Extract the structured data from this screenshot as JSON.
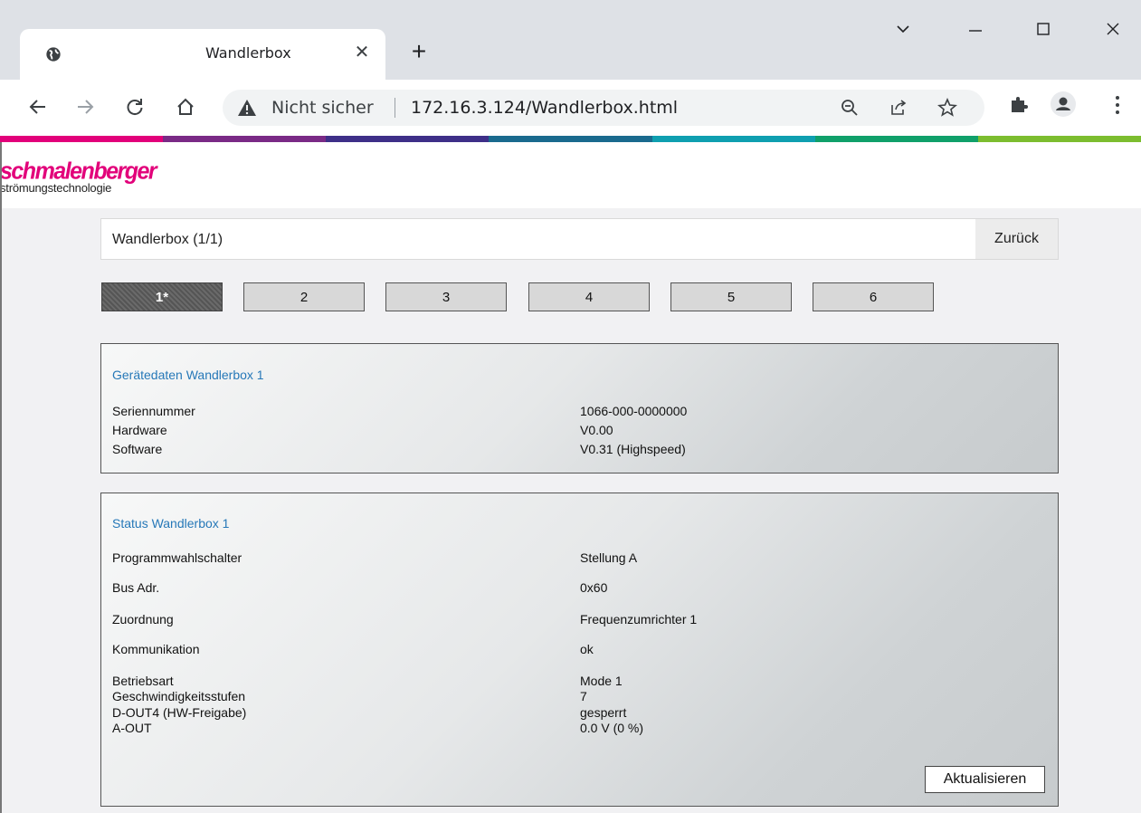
{
  "browser": {
    "tab_title": "Wandlerbox",
    "tab_close": "✕",
    "new_tab": "+",
    "not_secure": "Nicht sicher",
    "url": "172.16.3.124/Wandlerbox.html"
  },
  "colorbar": [
    "#e2007a",
    "#7a2a86",
    "#3e2f88",
    "#1a6a8e",
    "#0f9fb0",
    "#10a06a",
    "#7cbd2f"
  ],
  "logo": {
    "main": "schmalenberger",
    "sub": "strömungstechnologie"
  },
  "titlebar": {
    "title": "Wandlerbox (1/1)",
    "back_label": "Zurück"
  },
  "tabs": [
    "1*",
    "2",
    "3",
    "4",
    "5",
    "6"
  ],
  "device": {
    "title": "Gerätedaten Wandlerbox 1",
    "rows": [
      {
        "label": "Seriennummer",
        "value": "1066-000-0000000"
      },
      {
        "label": "Hardware",
        "value": "V0.00"
      },
      {
        "label": "Software",
        "value": "V0.31 (Highspeed)"
      }
    ]
  },
  "status": {
    "title": "Status Wandlerbox 1",
    "rows": [
      {
        "label": "Programmwahlschalter",
        "value": "Stellung A"
      },
      {
        "label": "Bus Adr.",
        "value": "0x60"
      },
      {
        "label": "Zuordnung",
        "value": "Frequenzumrichter 1"
      },
      {
        "label": "Kommunikation",
        "value": "ok"
      },
      {
        "label": "Betriebsart",
        "value": "Mode 1"
      },
      {
        "label": "Geschwindigkeitsstufen",
        "value": "7"
      },
      {
        "label": "D-OUT4 (HW-Freigabe)",
        "value": "gesperrt"
      },
      {
        "label": "A-OUT",
        "value": "0.0 V (0 %)"
      }
    ],
    "refresh_label": "Aktualisieren"
  }
}
